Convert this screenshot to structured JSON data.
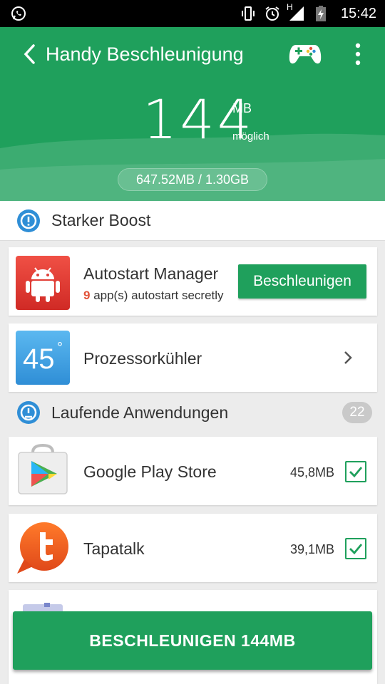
{
  "status_bar": {
    "time": "15:42",
    "network_label": "H",
    "icons": [
      "whatsapp-icon",
      "vibrate-icon",
      "alarm-icon",
      "signal-icon",
      "battery-charging-icon"
    ]
  },
  "header": {
    "title": "Handy Beschleunigung",
    "boost_value": "144",
    "boost_unit": "MB",
    "boost_caption": "möglich",
    "memory_usage": "647.52MB / 1.30GB",
    "icons": [
      "back-arrow-icon",
      "gamepad-icon",
      "more-vert-icon"
    ]
  },
  "sections": {
    "strong_boost": {
      "title": "Starker Boost",
      "icon": "info-icon"
    },
    "running_apps": {
      "title": "Laufende Anwendungen",
      "count": "22",
      "icon": "speedometer-icon"
    }
  },
  "autostart_card": {
    "title": "Autostart Manager",
    "sub_count": "9",
    "sub_text": " app(s) autostart secretly",
    "button_label": "Beschleunigen",
    "icon": "android-icon"
  },
  "cpu_card": {
    "title": "Prozessorkühler",
    "temp_value": "45",
    "temp_unit": "°",
    "icon": "chevron-right-icon"
  },
  "apps": [
    {
      "name": "Google Play Store",
      "size": "45,8MB",
      "checked": true,
      "icon": "play-store-icon"
    },
    {
      "name": "Tapatalk",
      "size": "39,1MB",
      "checked": true,
      "icon": "tapatalk-icon"
    }
  ],
  "bottom_button": {
    "label": "BESCHLEUNIGEN 144MB"
  },
  "colors": {
    "accent_green": "#1fa05c",
    "section_icon_blue": "#2f8ed6",
    "highlight_red": "#e2543b",
    "background": "#ececec"
  }
}
